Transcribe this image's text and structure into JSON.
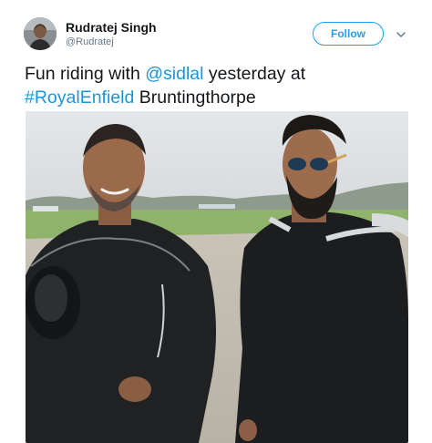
{
  "user": {
    "display_name": "Rudratej Singh",
    "handle": "@Rudratej"
  },
  "follow_label": "Follow",
  "tweet": {
    "text_prefix": "Fun riding with ",
    "mention": "@sidlal",
    "text_middle": " yesterday at",
    "hashtag": "#RoyalEnfield",
    "text_suffix": " Bruntingthorpe"
  },
  "icons": {
    "caret": "chevron-down-icon"
  },
  "colors": {
    "link": "#1b95e0",
    "follow_border": "#1da1f2"
  }
}
